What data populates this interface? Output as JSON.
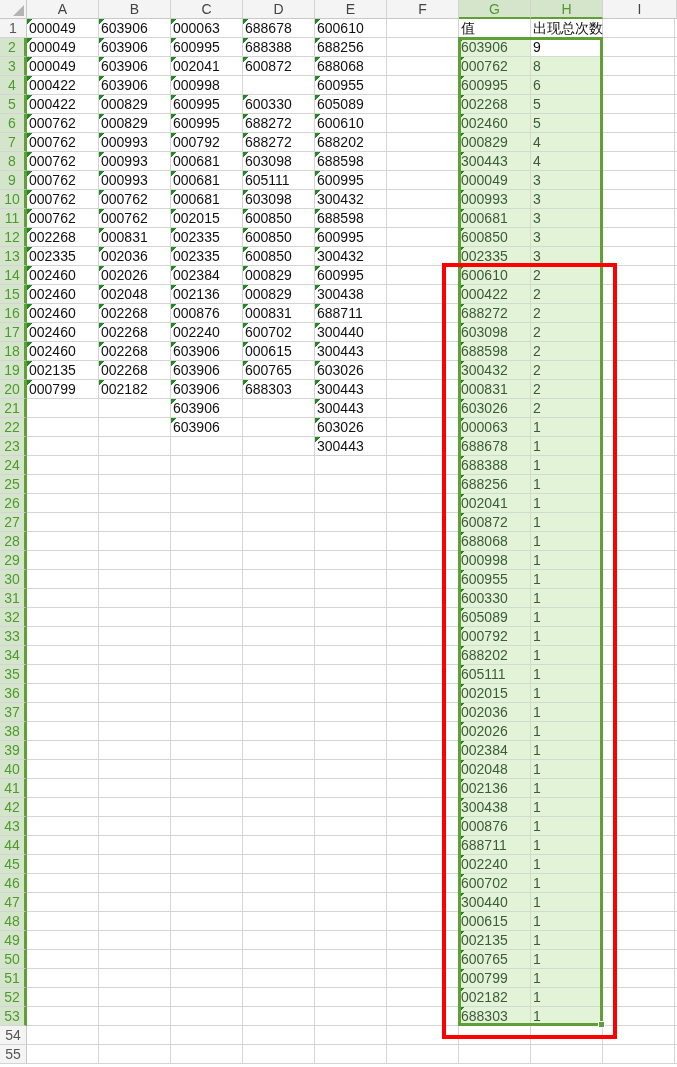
{
  "column_headers": [
    {
      "label": "A",
      "selected": false
    },
    {
      "label": "B",
      "selected": false
    },
    {
      "label": "C",
      "selected": false
    },
    {
      "label": "D",
      "selected": false
    },
    {
      "label": "E",
      "selected": false
    },
    {
      "label": "F",
      "selected": false
    },
    {
      "label": "G",
      "selected": true
    },
    {
      "label": "H",
      "selected": true
    },
    {
      "label": "I",
      "selected": false
    }
  ],
  "row_headers": [
    {
      "label": "1",
      "selected": false
    },
    {
      "label": "2",
      "selected": true
    },
    {
      "label": "3",
      "selected": true
    },
    {
      "label": "4",
      "selected": true
    },
    {
      "label": "5",
      "selected": true
    },
    {
      "label": "6",
      "selected": true
    },
    {
      "label": "7",
      "selected": true
    },
    {
      "label": "8",
      "selected": true
    },
    {
      "label": "9",
      "selected": true
    },
    {
      "label": "10",
      "selected": true
    },
    {
      "label": "11",
      "selected": true
    },
    {
      "label": "12",
      "selected": true
    },
    {
      "label": "13",
      "selected": true
    },
    {
      "label": "14",
      "selected": true
    },
    {
      "label": "15",
      "selected": true
    },
    {
      "label": "16",
      "selected": true
    },
    {
      "label": "17",
      "selected": true
    },
    {
      "label": "18",
      "selected": true
    },
    {
      "label": "19",
      "selected": true
    },
    {
      "label": "20",
      "selected": true
    },
    {
      "label": "21",
      "selected": true
    },
    {
      "label": "22",
      "selected": true
    },
    {
      "label": "23",
      "selected": true
    },
    {
      "label": "24",
      "selected": true
    },
    {
      "label": "25",
      "selected": true
    },
    {
      "label": "26",
      "selected": true
    },
    {
      "label": "27",
      "selected": true
    },
    {
      "label": "28",
      "selected": true
    },
    {
      "label": "29",
      "selected": true
    },
    {
      "label": "30",
      "selected": true
    },
    {
      "label": "31",
      "selected": true
    },
    {
      "label": "32",
      "selected": true
    },
    {
      "label": "33",
      "selected": true
    },
    {
      "label": "34",
      "selected": true
    },
    {
      "label": "35",
      "selected": true
    },
    {
      "label": "36",
      "selected": true
    },
    {
      "label": "37",
      "selected": true
    },
    {
      "label": "38",
      "selected": true
    },
    {
      "label": "39",
      "selected": true
    },
    {
      "label": "40",
      "selected": true
    },
    {
      "label": "41",
      "selected": true
    },
    {
      "label": "42",
      "selected": true
    },
    {
      "label": "43",
      "selected": true
    },
    {
      "label": "44",
      "selected": true
    },
    {
      "label": "45",
      "selected": true
    },
    {
      "label": "46",
      "selected": true
    },
    {
      "label": "47",
      "selected": true
    },
    {
      "label": "48",
      "selected": true
    },
    {
      "label": "49",
      "selected": true
    },
    {
      "label": "50",
      "selected": true
    },
    {
      "label": "51",
      "selected": true
    },
    {
      "label": "52",
      "selected": true
    },
    {
      "label": "53",
      "selected": true
    },
    {
      "label": "54",
      "selected": false
    },
    {
      "label": "55",
      "selected": false
    }
  ],
  "number_as_text": true,
  "data_columns": [
    [
      "000049",
      "000049",
      "000049",
      "000422",
      "000422",
      "000762",
      "000762",
      "000762",
      "000762",
      "000762",
      "000762",
      "002268",
      "002335",
      "002460",
      "002460",
      "002460",
      "002460",
      "002460",
      "002135",
      "000799"
    ],
    [
      "603906",
      "603906",
      "603906",
      "603906",
      "000829",
      "000829",
      "000993",
      "000993",
      "000993",
      "000762",
      "000762",
      "000831",
      "002036",
      "002026",
      "002048",
      "002268",
      "002268",
      "002268",
      "002268",
      "002182"
    ],
    [
      "000063",
      "600995",
      "002041",
      "000998",
      "600995",
      "600995",
      "000792",
      "000681",
      "000681",
      "000681",
      "002015",
      "002335",
      "002335",
      "002384",
      "002136",
      "000876",
      "002240",
      "603906",
      "603906",
      "603906",
      "603906",
      "603906"
    ],
    [
      "688678",
      "688388",
      "600872",
      null,
      "600330",
      "688272",
      "688272",
      "603098",
      "605111",
      "603098",
      "600850",
      "600850",
      "600850",
      "000829",
      "000829",
      "000831",
      "600702",
      "000615",
      "600765",
      "688303"
    ],
    [
      "600610",
      "688256",
      "688068",
      "600955",
      "605089",
      "600610",
      "688202",
      "688598",
      "600995",
      "300432",
      "688598",
      "600995",
      "300432",
      "600995",
      "300438",
      "688711",
      "300440",
      "300443",
      "603026",
      "300443",
      "300443",
      "603026",
      "300443"
    ]
  ],
  "result": {
    "headers": [
      "值",
      "出现总次数"
    ],
    "selected": true,
    "groups": [
      {
        "boxed": false,
        "rows": [
          {
            "value": "603906",
            "count": "9",
            "active": true
          },
          {
            "value": "000762",
            "count": "8",
            "active": false
          },
          {
            "value": "600995",
            "count": "6",
            "active": false
          },
          {
            "value": "002268",
            "count": "5",
            "active": false
          },
          {
            "value": "002460",
            "count": "5",
            "active": false
          },
          {
            "value": "000829",
            "count": "4",
            "active": false
          },
          {
            "value": "300443",
            "count": "4",
            "active": false
          },
          {
            "value": "000049",
            "count": "3",
            "active": false
          },
          {
            "value": "000993",
            "count": "3",
            "active": false
          },
          {
            "value": "000681",
            "count": "3",
            "active": false
          },
          {
            "value": "600850",
            "count": "3",
            "active": false
          },
          {
            "value": "002335",
            "count": "3",
            "active": false
          }
        ]
      },
      {
        "boxed": true,
        "rows": [
          {
            "value": "600610",
            "count": "2",
            "active": false
          },
          {
            "value": "000422",
            "count": "2",
            "active": false
          },
          {
            "value": "688272",
            "count": "2",
            "active": false
          },
          {
            "value": "603098",
            "count": "2",
            "active": false
          },
          {
            "value": "688598",
            "count": "2",
            "active": false
          },
          {
            "value": "300432",
            "count": "2",
            "active": false
          },
          {
            "value": "000831",
            "count": "2",
            "active": false
          },
          {
            "value": "603026",
            "count": "2",
            "active": false
          },
          {
            "value": "000063",
            "count": "1",
            "active": false
          },
          {
            "value": "688678",
            "count": "1",
            "active": false
          },
          {
            "value": "688388",
            "count": "1",
            "active": false
          },
          {
            "value": "688256",
            "count": "1",
            "active": false
          },
          {
            "value": "002041",
            "count": "1",
            "active": false
          },
          {
            "value": "600872",
            "count": "1",
            "active": false
          },
          {
            "value": "688068",
            "count": "1",
            "active": false
          },
          {
            "value": "000998",
            "count": "1",
            "active": false
          },
          {
            "value": "600955",
            "count": "1",
            "active": false
          },
          {
            "value": "600330",
            "count": "1",
            "active": false
          },
          {
            "value": "605089",
            "count": "1",
            "active": false
          },
          {
            "value": "000792",
            "count": "1",
            "active": false
          },
          {
            "value": "688202",
            "count": "1",
            "active": false
          },
          {
            "value": "605111",
            "count": "1",
            "active": false
          },
          {
            "value": "002015",
            "count": "1",
            "active": false
          },
          {
            "value": "002036",
            "count": "1",
            "active": false
          },
          {
            "value": "002026",
            "count": "1",
            "active": false
          },
          {
            "value": "002384",
            "count": "1",
            "active": false
          },
          {
            "value": "002048",
            "count": "1",
            "active": false
          },
          {
            "value": "002136",
            "count": "1",
            "active": false
          },
          {
            "value": "300438",
            "count": "1",
            "active": false
          },
          {
            "value": "000876",
            "count": "1",
            "active": false
          },
          {
            "value": "688711",
            "count": "1",
            "active": false
          },
          {
            "value": "002240",
            "count": "1",
            "active": false
          },
          {
            "value": "600702",
            "count": "1",
            "active": false
          },
          {
            "value": "300440",
            "count": "1",
            "active": false
          },
          {
            "value": "000615",
            "count": "1",
            "active": false
          },
          {
            "value": "002135",
            "count": "1",
            "active": false
          },
          {
            "value": "600765",
            "count": "1",
            "active": false
          },
          {
            "value": "000799",
            "count": "1",
            "active": false
          },
          {
            "value": "002182",
            "count": "1",
            "active": false
          },
          {
            "value": "688303",
            "count": "1",
            "active": false
          }
        ]
      }
    ]
  }
}
